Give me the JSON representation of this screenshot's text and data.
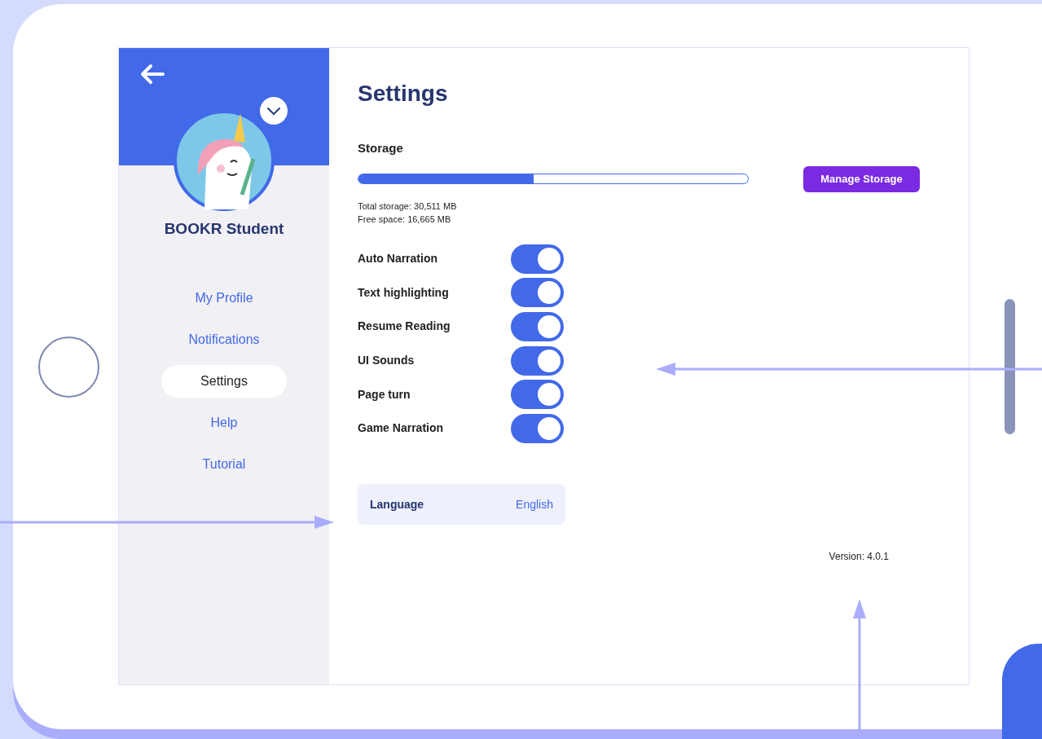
{
  "sidebar": {
    "profile_name": "BOOKR Student",
    "items": [
      {
        "label": "My Profile",
        "selected": false
      },
      {
        "label": "Notifications",
        "selected": false
      },
      {
        "label": "Settings",
        "selected": true
      },
      {
        "label": "Help",
        "selected": false
      },
      {
        "label": "Tutorial",
        "selected": false
      }
    ]
  },
  "page": {
    "title": "Settings",
    "storage": {
      "label": "Storage",
      "level": 0.45,
      "total": "Total storage:  30,511 MB",
      "free": "Free space:  16,665 MB",
      "button": "Manage Storage"
    },
    "toggles": [
      {
        "label": "Auto Narration",
        "on": true
      },
      {
        "label": "Text highlighting",
        "on": true
      },
      {
        "label": "Resume Reading",
        "on": true
      },
      {
        "label": "UI Sounds",
        "on": true
      },
      {
        "label": "Page turn",
        "on": true
      },
      {
        "label": "Game Narration",
        "on": true
      }
    ],
    "language": {
      "label": "Language",
      "value": "English"
    },
    "version": "Version:  4.0.1"
  }
}
